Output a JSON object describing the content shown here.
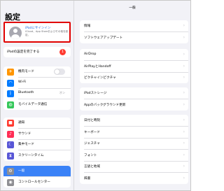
{
  "sidebar": {
    "title": "設定",
    "signin": {
      "title": "iPadにサインイン",
      "subtitle": "iCloud、App Storeおよびその他を設定。"
    },
    "finish_setup": {
      "label": "iPadの設定を完了する",
      "badge": "1"
    },
    "group1": [
      {
        "label": "機内モード",
        "icon": "airplane-icon",
        "color": "#ff9500",
        "glyph": "✈"
      },
      {
        "label": "Wi-Fi",
        "icon": "wifi-icon",
        "color": "#007aff",
        "glyph": "◠"
      },
      {
        "label": "Bluetooth",
        "value": "オン",
        "icon": "bluetooth-icon",
        "color": "#007aff",
        "glyph": "ᛒ"
      },
      {
        "label": "モバイルデータ通信",
        "icon": "cellular-icon",
        "color": "#34c759",
        "glyph": "◍"
      }
    ],
    "group2": [
      {
        "label": "通知",
        "icon": "notifications-icon",
        "color": "#ff3b30",
        "glyph": "■"
      },
      {
        "label": "サウンド",
        "icon": "sound-icon",
        "color": "#ff2d55",
        "glyph": "♪"
      },
      {
        "label": "集中モード",
        "icon": "focus-moon-icon",
        "color": "#5856d6",
        "glyph": "☾"
      },
      {
        "label": "スクリーンタイム",
        "icon": "screen-time-icon",
        "color": "#5856d6",
        "glyph": "⧗"
      }
    ],
    "group3": [
      {
        "label": "一般",
        "icon": "gear-icon",
        "color": "#8e8e93",
        "glyph": "⚙",
        "selected": true
      },
      {
        "label": "コントロールセンター",
        "icon": "control-center-icon",
        "color": "#8e8e93",
        "glyph": "◉"
      }
    ]
  },
  "detail": {
    "title": "一般",
    "groups": [
      [
        "情報",
        "ソフトウェアアップデート"
      ],
      [
        "AirDrop",
        "AirPlayとHandoff",
        "ピクチャインピクチャ"
      ],
      [
        "iPadストレージ",
        "Appのバックグラウンド更新"
      ],
      [
        "日付と時刻",
        "キーボード",
        "ジェスチャ",
        "フォント",
        "言語と地域",
        "辞書"
      ]
    ]
  }
}
